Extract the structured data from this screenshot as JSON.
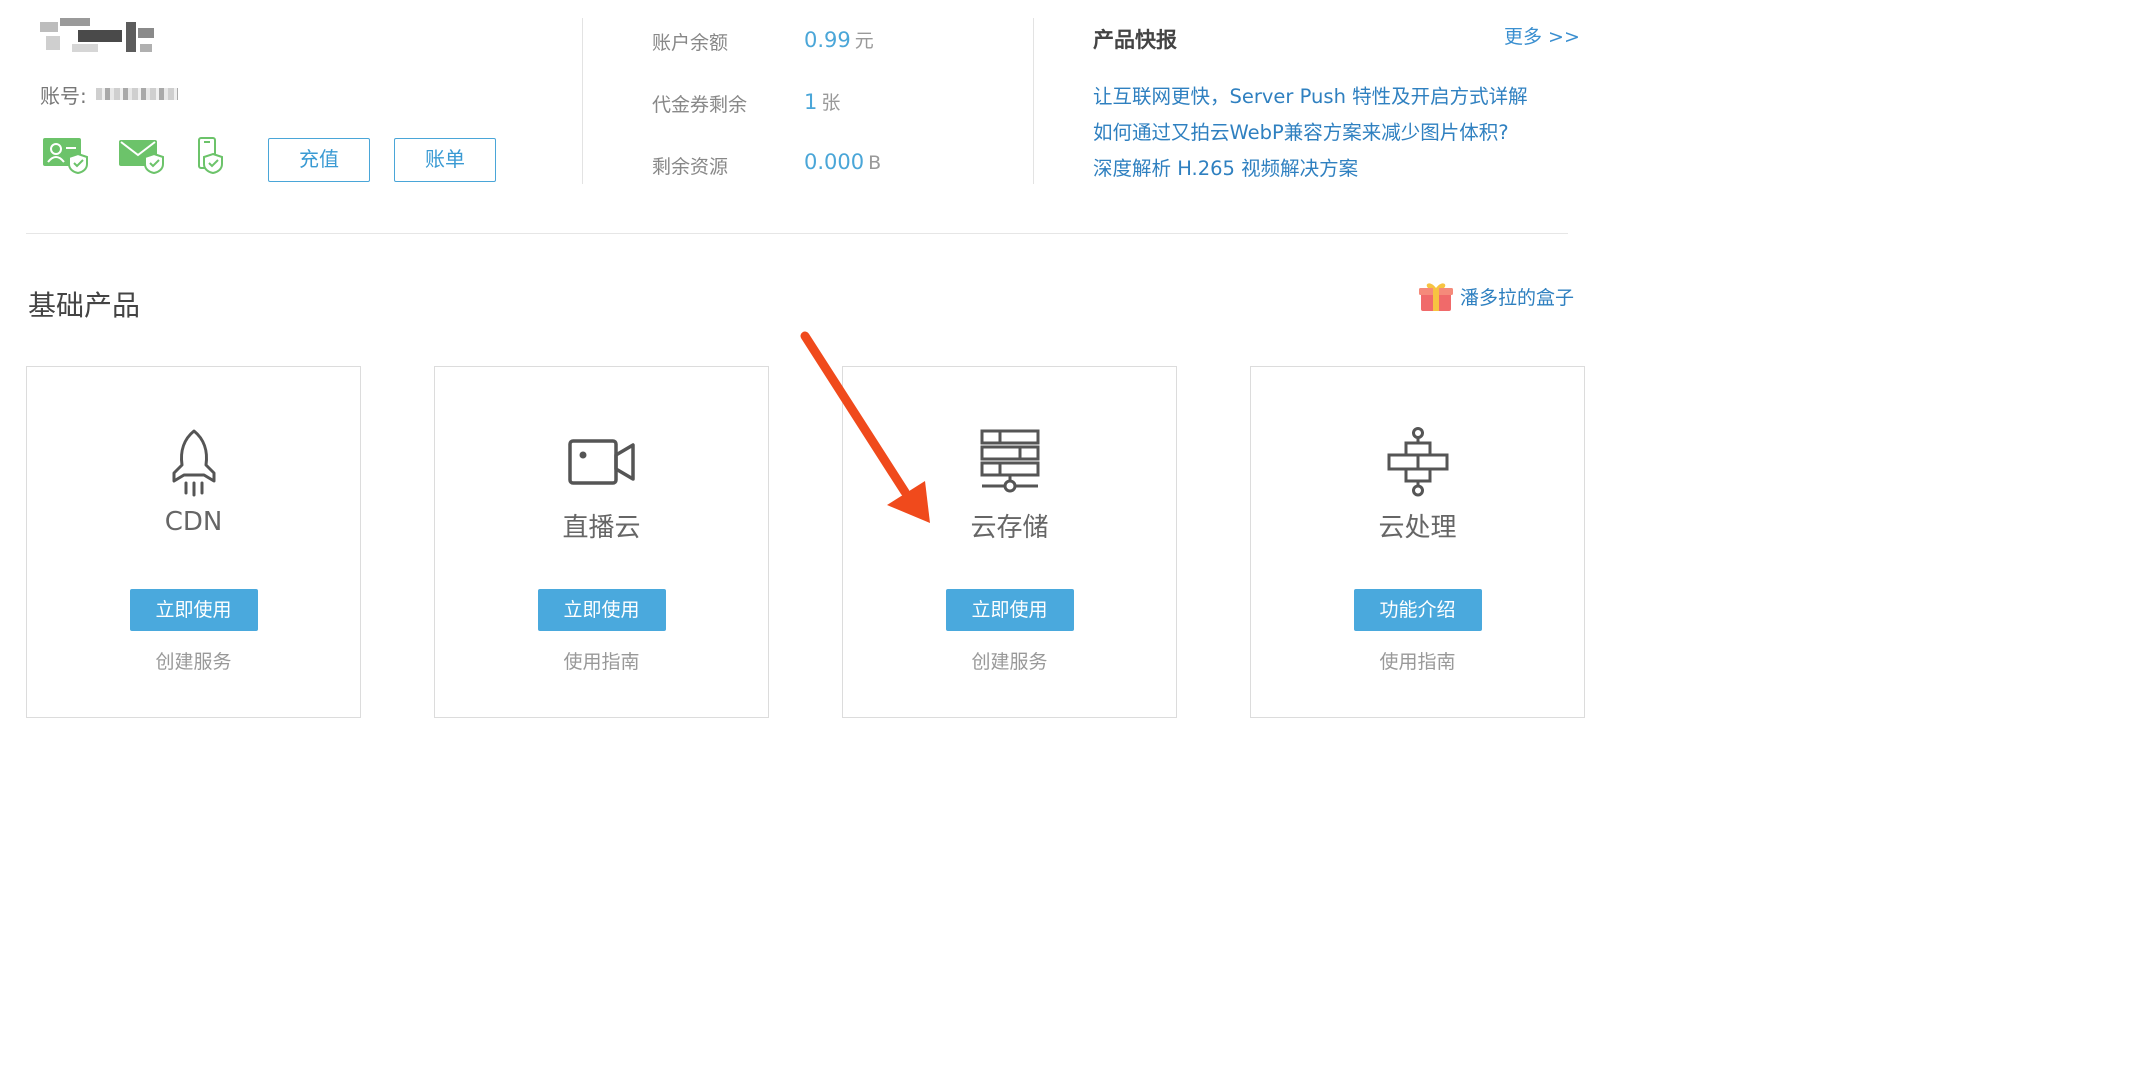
{
  "account": {
    "id_label": "账号:",
    "recharge_label": "充值",
    "bill_label": "账单"
  },
  "stats": [
    {
      "label": "账户余额",
      "value": "0.99",
      "unit": "元"
    },
    {
      "label": "代金券剩余",
      "value": "1",
      "unit": "张"
    },
    {
      "label": "剩余资源",
      "value": "0.000",
      "unit": "B"
    }
  ],
  "news": {
    "title": "产品快报",
    "more": "更多 >>",
    "items": [
      "让互联网更快，Server Push 特性及开启方式详解",
      "如何通过又拍云WebP兼容方案来减少图片体积?",
      "深度解析 H.265 视频解决方案"
    ]
  },
  "section": {
    "title": "基础产品",
    "promo": "潘多拉的盒子"
  },
  "products": [
    {
      "name": "CDN",
      "icon": "rocket-icon",
      "button": "立即使用",
      "link": "创建服务"
    },
    {
      "name": "直播云",
      "icon": "video-camera-icon",
      "button": "立即使用",
      "link": "使用指南"
    },
    {
      "name": "云存储",
      "icon": "storage-server-icon",
      "button": "立即使用",
      "link": "创建服务"
    },
    {
      "name": "云处理",
      "icon": "processing-network-icon",
      "button": "功能介绍",
      "link": "使用指南"
    }
  ],
  "colors": {
    "accent": "#4aa9dd",
    "link": "#2f80c0",
    "verify_green": "#6cc36a",
    "annotation_arrow": "#f04a1c"
  }
}
